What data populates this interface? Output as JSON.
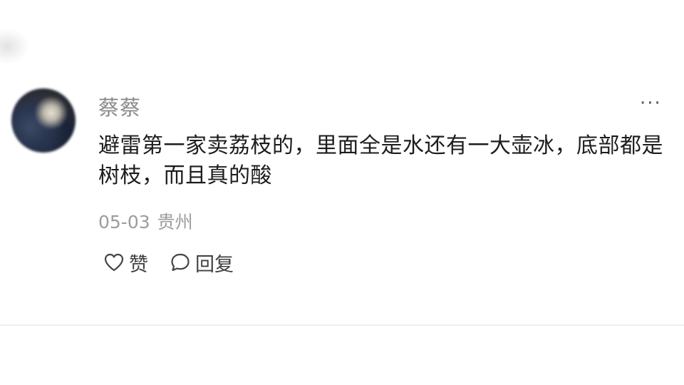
{
  "comment": {
    "username": "蔡蔡",
    "more_label": "···",
    "text": "避雷第一家卖荔枝的，里面全是水还有一大壶冰，底部都是树枝，而且真的酸",
    "date": "05-03",
    "location": "贵州",
    "like_label": "赞",
    "reply_label": "回复",
    "icons": {
      "like": "heart-outline-icon",
      "reply": "speech-bubble-icon"
    }
  }
}
